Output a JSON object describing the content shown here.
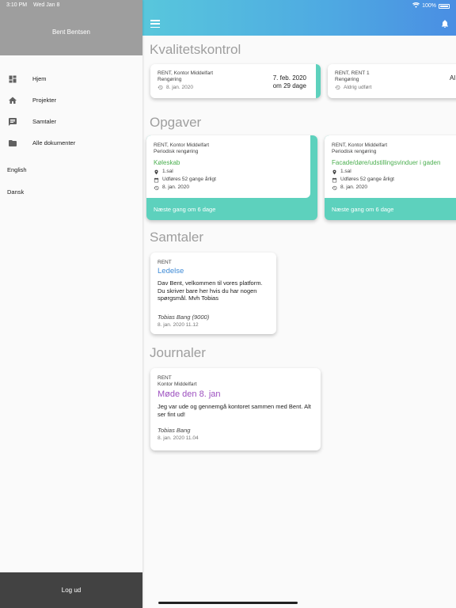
{
  "status": {
    "time": "3:10 PM",
    "date": "Wed Jan 8",
    "battery": "100%"
  },
  "sidebar": {
    "user_name": "Bent Bentsen",
    "items": [
      {
        "label": "Hjem",
        "icon": "dashboard-icon"
      },
      {
        "label": "Projekter",
        "icon": "home-icon"
      },
      {
        "label": "Samtaler",
        "icon": "chat-icon"
      },
      {
        "label": "Alle dokumenter",
        "icon": "folder-icon"
      }
    ],
    "languages": [
      "English",
      "Dansk"
    ],
    "logout": "Log ud"
  },
  "sections": {
    "kvalitet": "Kvalitetskontrol",
    "opgaver": "Opgaver",
    "samtaler": "Samtaler",
    "journaler": "Journaler"
  },
  "kvalitet_cards": [
    {
      "company": "RENT, Kontor Middelfart",
      "type": "Rengøring",
      "status": "8. jan. 2020",
      "date_line1": "7. feb. 2020",
      "date_line2": "om 29 dage",
      "accent": "#5dd1bd"
    },
    {
      "company": "RENT, RENT 1",
      "type": "Rengøring",
      "status": "Aldrig udført",
      "date_line1": "Al"
    }
  ],
  "opgave_cards": [
    {
      "company": "RENT, Kontor Middelfart",
      "type": "Periodisk rengøring",
      "title": "Køleskab",
      "location": "1.sal",
      "frequency": "Udføres 52 gange årligt",
      "date": "8. jan. 2020",
      "next": "Næste gang om 6 dage"
    },
    {
      "company": "RENT, Kontor Middelfart",
      "type": "Periodisk rengøring",
      "title": "Facade/døre/udstillingsvinduer i gaden",
      "location": "1.sal",
      "frequency": "Udføres 52 gange årligt",
      "date": "8. jan. 2020",
      "next": "Næste gang om 6 dage"
    }
  ],
  "samtale_card": {
    "company": "RENT",
    "title": "Ledelse",
    "message": "Dav Bent, velkommen til vores platform. Du skriver bare her hvis du har nogen spørgsmål. Mvh Tobias",
    "author": "Tobias Bang (9000)",
    "timestamp": "8. jan. 2020 11.12"
  },
  "journal_card": {
    "company": "RENT",
    "location": "Kontor Middelfart",
    "title": "Møde den 8. jan",
    "message": "Jeg var ude og gennemgå kontoret sammen med Bent. Alt ser fint ud!",
    "author": "Tobias Bang",
    "timestamp": "8. jan. 2020 11.04"
  },
  "colors": {
    "accent_teal": "#5dd1bd",
    "topbar_start": "#58c7dc",
    "topbar_end": "#4a8ee3",
    "link_blue": "#3d8ad6",
    "journal_purple": "#9c4fbf",
    "task_green": "#4caf50"
  }
}
